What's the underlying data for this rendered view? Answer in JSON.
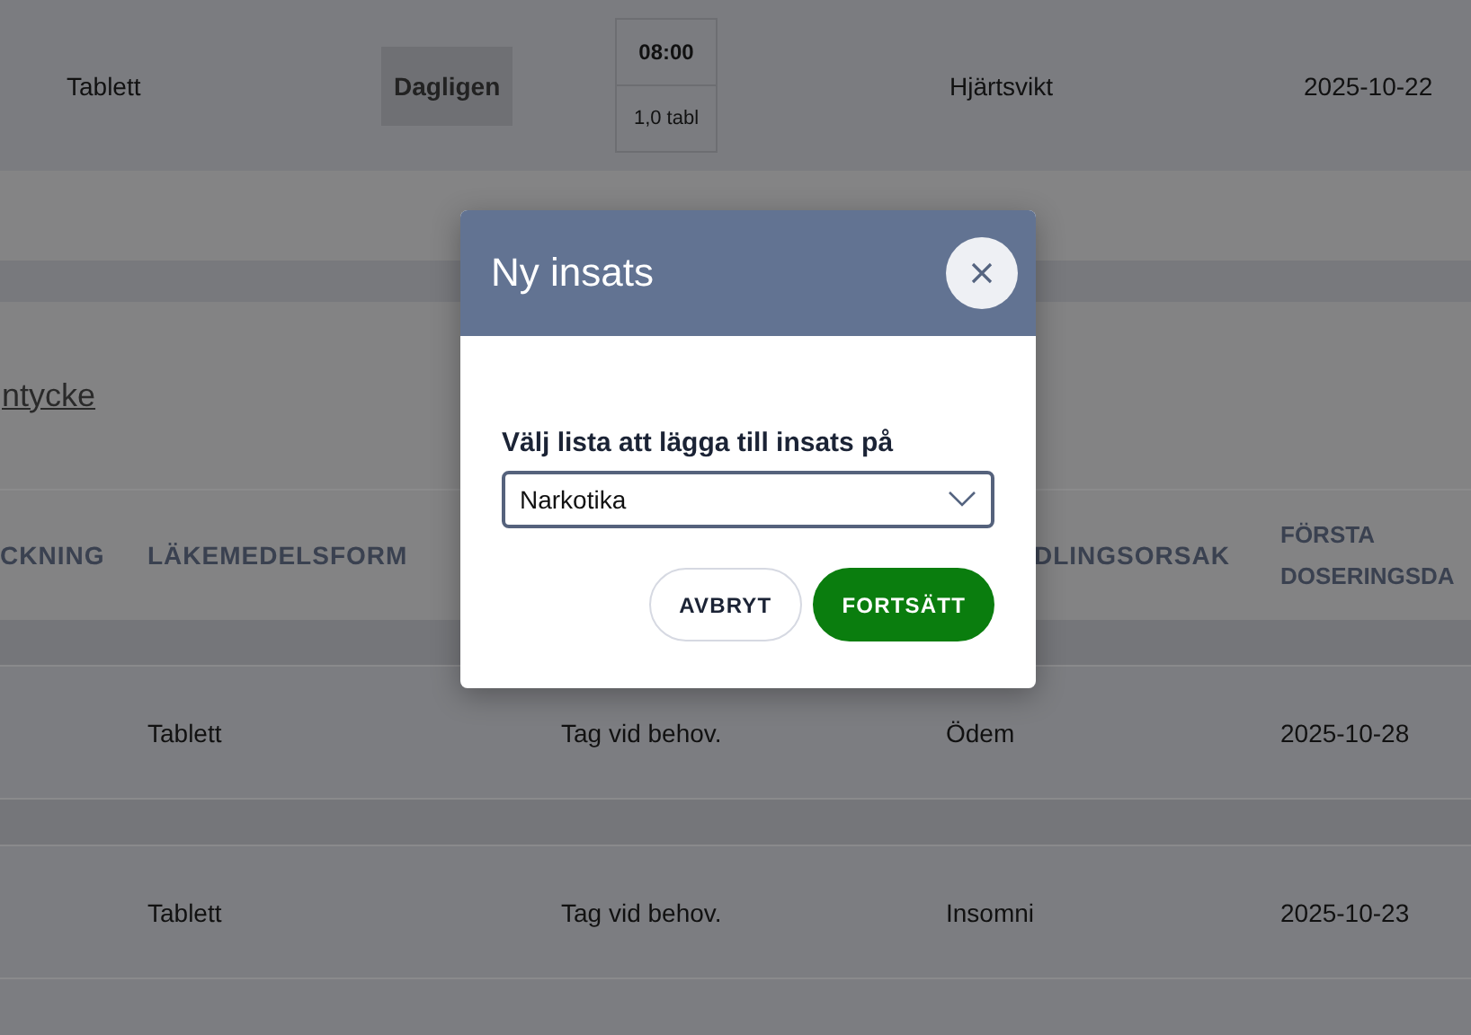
{
  "top_row": {
    "form": "Tablett",
    "frequency": "Dagligen",
    "dose_time": "08:00",
    "dose_amount": "1,0 tabl",
    "reason": "Hjärtsvikt",
    "start_date": "2025-10-22"
  },
  "link": "ntycke",
  "table": {
    "columns": [
      {
        "lines": [
          "CKNING"
        ]
      },
      {
        "lines": [
          "LÄKEMEDELSFORM"
        ]
      },
      {
        "lines": [
          "DLINGSORSAK"
        ]
      },
      {
        "lines": [
          "FÖRSTA",
          "DOSERINGSDA"
        ]
      }
    ],
    "rows": [
      {
        "form": "Tablett",
        "dosage": "Tag vid behov.",
        "reason": "Ödem",
        "start_date": "2025-10-28"
      },
      {
        "form": "Tablett",
        "dosage": "Tag vid behov.",
        "reason": "Insomni",
        "start_date": "2025-10-23"
      }
    ]
  },
  "modal": {
    "title": "Ny insats",
    "label": "Välj lista att lägga till insats på",
    "select_value": "Narkotika",
    "buttons": [
      {
        "label": "AVBRYT",
        "kind": "secondary"
      },
      {
        "label": "FORTSÄTT",
        "kind": "primary"
      }
    ]
  }
}
